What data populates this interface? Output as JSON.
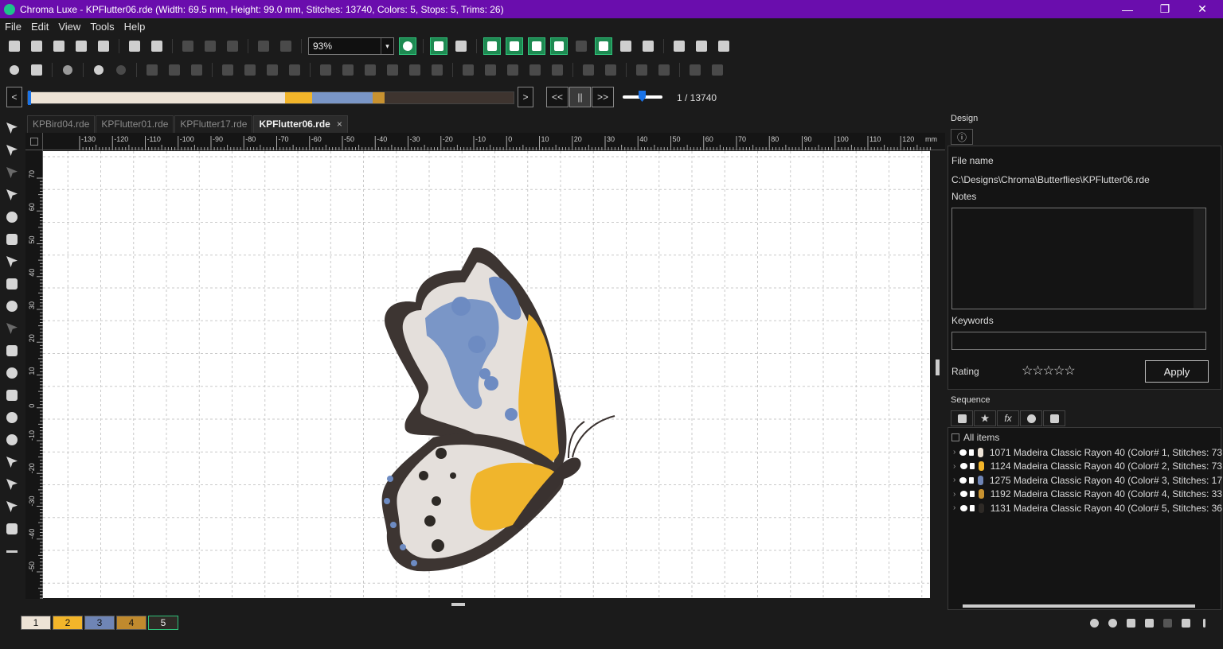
{
  "window": {
    "title": "Chroma Luxe - KPFlutter06.rde (Width: 69.5 mm, Height: 99.0 mm, Stitches: 13740, Colors: 5, Stops: 5, Trims: 26)",
    "minimize": "—",
    "restore": "❐",
    "close": "✕"
  },
  "menu": [
    "File",
    "Edit",
    "View",
    "Tools",
    "Help"
  ],
  "toolbar": {
    "zoom_value": "93%",
    "zoom_dropdown": "▾"
  },
  "sequence_bar": {
    "prev": "<",
    "next": ">",
    "rewind": "<<",
    "pause": "||",
    "forward": ">>",
    "stitch_position": "1 / 13740",
    "progress": 0.0001,
    "color_blocks": [
      {
        "color": "#ede3d6",
        "weight": 320
      },
      {
        "color": "#f2b52a",
        "weight": 33
      },
      {
        "color": "#7a96c7",
        "weight": 76
      },
      {
        "color": "#c89230",
        "weight": 15
      },
      {
        "color": "#3e342f",
        "weight": 160
      }
    ]
  },
  "tabs": [
    {
      "label": "KPBird04.rde",
      "active": false
    },
    {
      "label": "KPFlutter01.rde",
      "active": false
    },
    {
      "label": "KPFlutter17.rde",
      "active": false
    },
    {
      "label": "KPFlutter06.rde",
      "active": true
    }
  ],
  "tab_close": "×",
  "ruler": {
    "h_labels": [
      "-130",
      "-120",
      "-110",
      "-100",
      "-90",
      "-80",
      "-70",
      "-60",
      "-50",
      "-40",
      "-30",
      "-20",
      "-10",
      "0",
      "10",
      "20",
      "30",
      "40",
      "50",
      "60",
      "70",
      "80",
      "90",
      "100",
      "110",
      "120"
    ],
    "unit": "mm",
    "v_labels": [
      "70",
      "60",
      "50",
      "40",
      "30",
      "20",
      "10",
      "0",
      "-10",
      "-20",
      "-30",
      "-40",
      "-50"
    ]
  },
  "color_swatches": [
    {
      "label": "1",
      "color": "#ede3d6"
    },
    {
      "label": "2",
      "color": "#f2b52a"
    },
    {
      "label": "3",
      "color": "#6f85b5"
    },
    {
      "label": "4",
      "color": "#c08a2e"
    },
    {
      "label": "5",
      "color": "#2e2a26"
    }
  ],
  "design_panel": {
    "section_title": "Design",
    "info_tab_icon": "ⓘ",
    "file_name_label": "File name",
    "file_name_value": "C:\\Designs\\Chroma\\Butterflies\\KPFlutter06.rde",
    "notes_label": "Notes",
    "keywords_label": "Keywords",
    "rating_label": "Rating",
    "rating_stars": "☆☆☆☆☆",
    "apply_button": "Apply"
  },
  "sequence_panel": {
    "section_title": "Sequence",
    "all_items_label": "All items",
    "fx_label": "fx",
    "items": [
      {
        "text": "1071 Madeira Classic Rayon 40 (Color# 1, Stitches: 73",
        "color": "#ede3d6"
      },
      {
        "text": "1124 Madeira Classic Rayon 40 (Color# 2, Stitches: 73",
        "color": "#f2b52a"
      },
      {
        "text": "1275 Madeira Classic Rayon 40 (Color# 3, Stitches: 17",
        "color": "#6f85b5"
      },
      {
        "text": "1192 Madeira Classic Rayon 40 (Color# 4, Stitches: 33",
        "color": "#c89230"
      },
      {
        "text": "1131 Madeira Classic Rayon 40 (Color# 5, Stitches: 36",
        "color": "#2e2a26"
      }
    ]
  }
}
